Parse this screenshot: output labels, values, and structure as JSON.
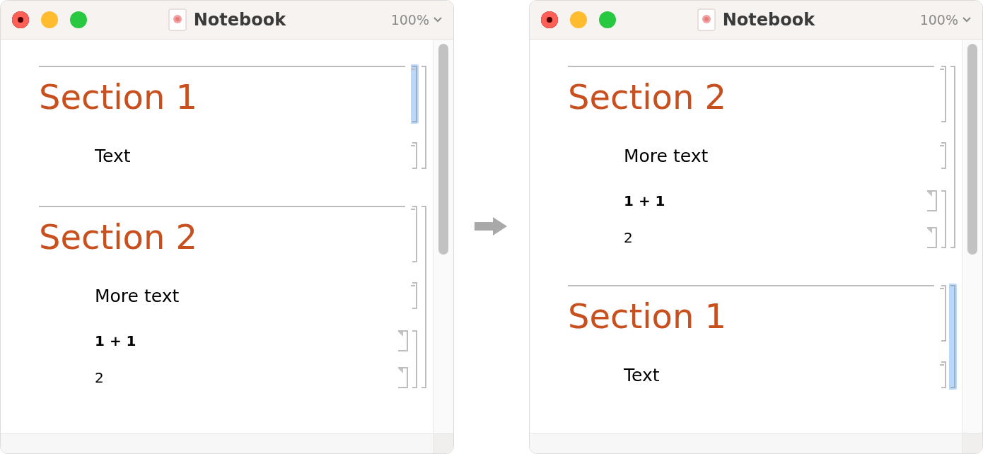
{
  "windows": [
    {
      "title": "Notebook",
      "zoom": "100%",
      "cells": [
        {
          "kind": "group",
          "selected": false,
          "cells": [
            {
              "kind": "section",
              "text": "Section 1",
              "selected": true
            },
            {
              "kind": "text",
              "text": "Text",
              "selected": false
            }
          ]
        },
        {
          "kind": "group",
          "selected": false,
          "cells": [
            {
              "kind": "section",
              "text": "Section 2",
              "selected": false
            },
            {
              "kind": "text",
              "text": "More text",
              "selected": false
            },
            {
              "kind": "group",
              "selected": false,
              "cells": [
                {
                  "kind": "input",
                  "text": "1 + 1",
                  "selected": false
                },
                {
                  "kind": "output",
                  "text": "2",
                  "selected": false
                }
              ]
            }
          ]
        }
      ]
    },
    {
      "title": "Notebook",
      "zoom": "100%",
      "cells": [
        {
          "kind": "group",
          "selected": false,
          "cells": [
            {
              "kind": "section",
              "text": "Section 2",
              "selected": false
            },
            {
              "kind": "text",
              "text": "More text",
              "selected": false
            },
            {
              "kind": "group",
              "selected": false,
              "cells": [
                {
                  "kind": "input",
                  "text": "1 + 1",
                  "selected": false
                },
                {
                  "kind": "output",
                  "text": "2",
                  "selected": false
                }
              ]
            }
          ]
        },
        {
          "kind": "group",
          "selected": true,
          "cells": [
            {
              "kind": "section",
              "text": "Section 1",
              "selected": false
            },
            {
              "kind": "text",
              "text": "Text",
              "selected": false
            }
          ]
        }
      ]
    }
  ]
}
